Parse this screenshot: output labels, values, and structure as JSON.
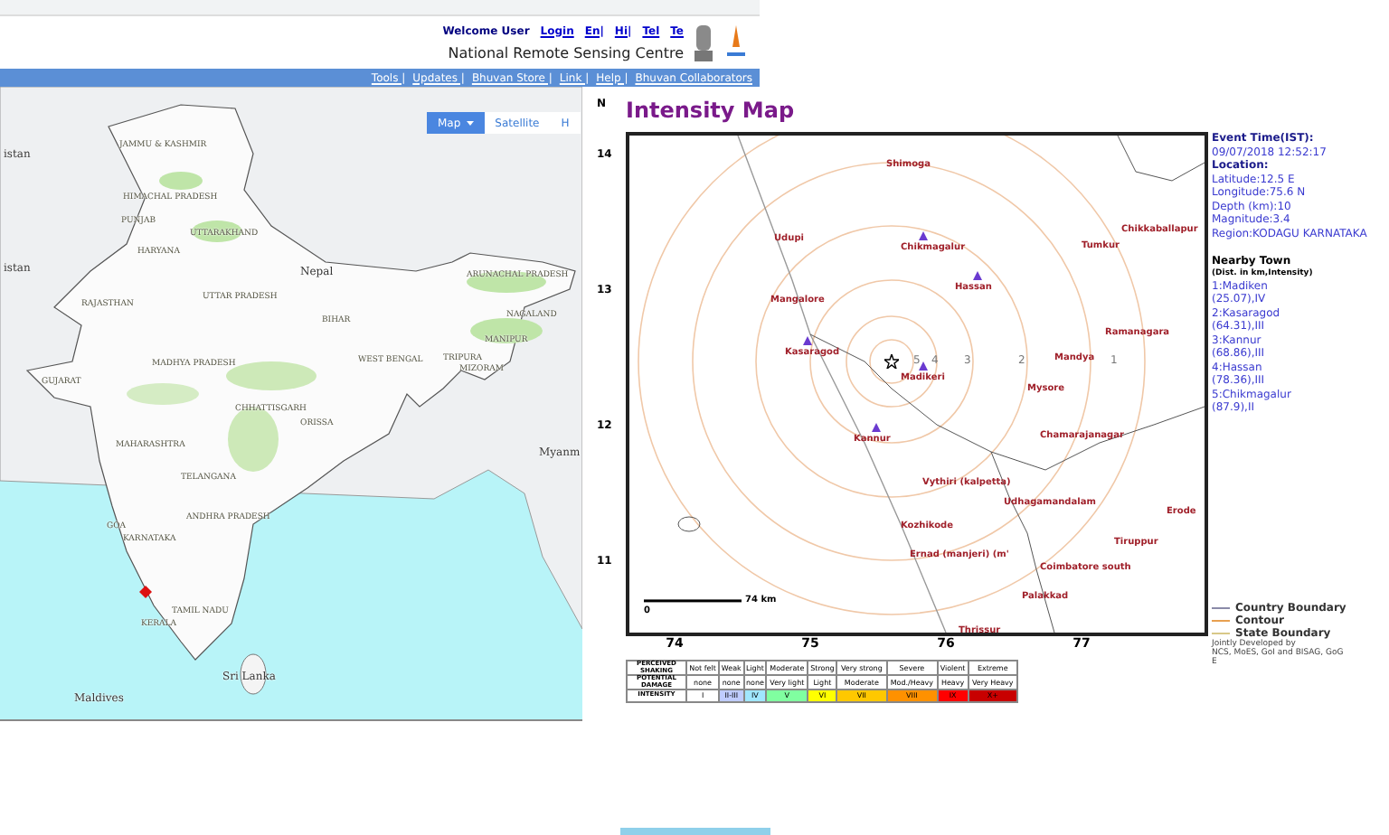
{
  "header": {
    "welcome": "Welcome User",
    "login": "Login",
    "languages": [
      "En|",
      "Hi|",
      "Tel",
      "Te"
    ],
    "org": "National Remote Sensing Centre"
  },
  "nav_links": [
    "Tools |",
    "Updates |",
    "Bhuvan Store |",
    "Link |",
    "Help |",
    "Bhuvan Collaborators"
  ],
  "map_types": [
    {
      "label": "Map",
      "selected": true
    },
    {
      "label": "Satellite",
      "selected": false
    },
    {
      "label": "H",
      "selected": false
    }
  ],
  "india_labels": [
    {
      "text": "istan",
      "kind": "country"
    },
    {
      "text": "JAMMU & KASHMIR",
      "kind": "state"
    },
    {
      "text": "HIMACHAL PRADESH",
      "kind": "state"
    },
    {
      "text": "PUNJAB",
      "kind": "state"
    },
    {
      "text": "UTTARAKHAND",
      "kind": "state"
    },
    {
      "text": "HARYANA",
      "kind": "state"
    },
    {
      "text": "istan",
      "kind": "country"
    },
    {
      "text": "Nepal",
      "kind": "country"
    },
    {
      "text": "ARUNACHAL PRADESH",
      "kind": "state"
    },
    {
      "text": "RAJASTHAN",
      "kind": "state"
    },
    {
      "text": "UTTAR PRADESH",
      "kind": "state"
    },
    {
      "text": "BIHAR",
      "kind": "state"
    },
    {
      "text": "NAGALAND",
      "kind": "state"
    },
    {
      "text": "MANIPUR",
      "kind": "state"
    },
    {
      "text": "MADHYA PRADESH",
      "kind": "state"
    },
    {
      "text": "WEST BENGAL",
      "kind": "state"
    },
    {
      "text": "TRIPURA",
      "kind": "state"
    },
    {
      "text": "MIZORAM",
      "kind": "state"
    },
    {
      "text": "GUJARAT",
      "kind": "state"
    },
    {
      "text": "CHHATTISGARH",
      "kind": "state"
    },
    {
      "text": "ORISSA",
      "kind": "state"
    },
    {
      "text": "MAHARASHTRA",
      "kind": "state"
    },
    {
      "text": "Myanm",
      "kind": "country"
    },
    {
      "text": "TELANGANA",
      "kind": "state"
    },
    {
      "text": "ANDHRA PRADESH",
      "kind": "state"
    },
    {
      "text": "GOA",
      "kind": "state"
    },
    {
      "text": "KARNATAKA",
      "kind": "state"
    },
    {
      "text": "TAMIL NADU",
      "kind": "state"
    },
    {
      "text": "KERALA",
      "kind": "state"
    },
    {
      "text": "Sri Lanka",
      "kind": "country"
    },
    {
      "text": "Maldives",
      "kind": "country"
    }
  ],
  "intensity_map": {
    "compass": "N",
    "title": "Intensity Map",
    "lat_ticks": [
      "14",
      "13",
      "12",
      "11"
    ],
    "lon_ticks": [
      "74",
      "75",
      "76",
      "77"
    ],
    "ring_labels": [
      "5",
      "4",
      "3",
      "2",
      "1"
    ],
    "scale_start": "0",
    "scale_end": "74 km",
    "towns": [
      {
        "name": "Shimoga",
        "nearby": false
      },
      {
        "name": "Udupi",
        "nearby": false
      },
      {
        "name": "Chikmagalur",
        "nearby": true
      },
      {
        "name": "Tumkur",
        "nearby": false
      },
      {
        "name": "Chikkaballapur",
        "nearby": false
      },
      {
        "name": "Hassan",
        "nearby": true
      },
      {
        "name": "Mangalore",
        "nearby": false
      },
      {
        "name": "Ramanagara",
        "nearby": false
      },
      {
        "name": "Kasaragod",
        "nearby": true
      },
      {
        "name": "Mandya",
        "nearby": false
      },
      {
        "name": "Madikeri",
        "nearby": true
      },
      {
        "name": "Mysore",
        "nearby": false
      },
      {
        "name": "Kannur",
        "nearby": true
      },
      {
        "name": "Chamarajanagar",
        "nearby": false
      },
      {
        "name": "Vythiri (kalpetta)",
        "nearby": false
      },
      {
        "name": "Udhagamandalam",
        "nearby": false
      },
      {
        "name": "Erode",
        "nearby": false
      },
      {
        "name": "Kozhikode",
        "nearby": false
      },
      {
        "name": "Tiruppur",
        "nearby": false
      },
      {
        "name": "Ernad (manjeri) (m'",
        "nearby": false
      },
      {
        "name": "Coimbatore south",
        "nearby": false
      },
      {
        "name": "Palakkad",
        "nearby": false
      },
      {
        "name": "Thrissur",
        "nearby": false
      }
    ]
  },
  "event_info": [
    {
      "kind": "heading",
      "text": "Event Time(IST):"
    },
    {
      "kind": "value",
      "text": "09/07/2018 12:52:17"
    },
    {
      "kind": "heading",
      "text": "Location:"
    },
    {
      "kind": "value",
      "text": "Latitude:12.5 E"
    },
    {
      "kind": "value",
      "text": "Longitude:75.6 N"
    },
    {
      "kind": "value",
      "text": "Depth (km):10"
    },
    {
      "kind": "value",
      "text": "Magnitude:3.4"
    },
    {
      "kind": "value",
      "text": "Region:KODAGU KARNATAKA"
    }
  ],
  "nearby": {
    "title": "Nearby Town",
    "subtitle": "(Dist. in km,Intensity)",
    "towns": [
      {
        "name": "1:Madiken",
        "detail": "(25.07),IV"
      },
      {
        "name": "2:Kasaragod",
        "detail": "(64.31),III"
      },
      {
        "name": "3:Kannur",
        "detail": "(68.86),III"
      },
      {
        "name": "4:Hassan",
        "detail": "(78.36),III"
      },
      {
        "name": "5:Chikmagalur",
        "detail": "(87.9),II"
      }
    ]
  },
  "boundary_legend": [
    {
      "label": "Country Boundary",
      "color": "#8a8aa8"
    },
    {
      "label": "Contour",
      "color": "#e8a050"
    },
    {
      "label": "State Boundary",
      "color": "#d8c888"
    }
  ],
  "credits": [
    "Jointly Developed by",
    "NCS, MoES, GoI and BISAG, GoG",
    "E"
  ],
  "intensity_scale": {
    "rows": [
      {
        "header": "PERCEIVED SHAKING",
        "cells": [
          "Not felt",
          "Weak",
          "Light",
          "Moderate",
          "Strong",
          "Very strong",
          "Severe",
          "Violent",
          "Extreme"
        ]
      },
      {
        "header": "POTENTIAL DAMAGE",
        "cells": [
          "none",
          "none",
          "none",
          "Very light",
          "Light",
          "Moderate",
          "Mod./Heavy",
          "Heavy",
          "Very Heavy"
        ]
      }
    ],
    "intensity_header": "INTENSITY",
    "levels": [
      {
        "label": "I",
        "color": "#ffffff"
      },
      {
        "label": "II-III",
        "color": "#bfccff"
      },
      {
        "label": "IV",
        "color": "#a0e6ff"
      },
      {
        "label": "V",
        "color": "#80ffa0"
      },
      {
        "label": "VI",
        "color": "#ffff00"
      },
      {
        "label": "VII",
        "color": "#ffc800"
      },
      {
        "label": "VIII",
        "color": "#ff9100"
      },
      {
        "label": "IX",
        "color": "#ff0000"
      },
      {
        "label": "X+",
        "color": "#c80000"
      }
    ]
  }
}
